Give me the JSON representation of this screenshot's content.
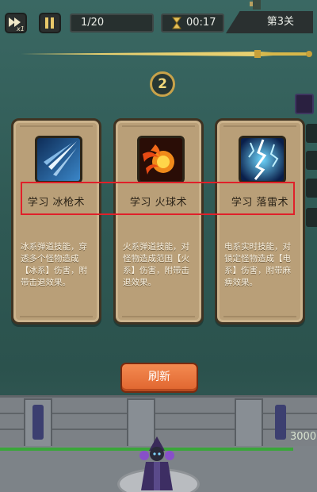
{
  "hud": {
    "wave": "1/20",
    "timer": "00:17",
    "stage": "第3关",
    "speed": "x1"
  },
  "round_badge": "2",
  "cards": [
    {
      "title": "学习 冰枪术",
      "desc": "冰系弹道技能，穿透多个怪物造成【冰系】伤害，附带击退效果。",
      "icon": "ice-spear-icon"
    },
    {
      "title": "学习 火球术",
      "desc": "火系弹道技能，对怪物造成范围【火系】伤害，附带击退效果。",
      "icon": "fireball-icon"
    },
    {
      "title": "学习 落雷术",
      "desc": "电系实时技能，对锁定怪物造成【电系】伤害，附带麻痹效果。",
      "icon": "lightning-icon"
    }
  ],
  "refresh_label": "刷新",
  "base_hp": "3000",
  "colors": {
    "card": "#b99f78",
    "refresh": "#e9743e",
    "highlight": "#e0202a",
    "hp_bar": "#3aa63a"
  }
}
